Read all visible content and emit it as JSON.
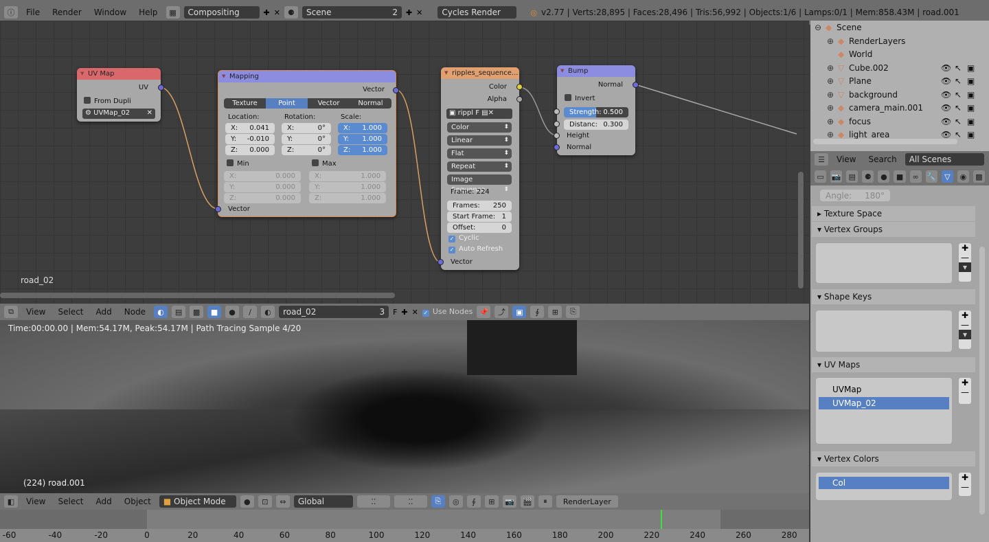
{
  "topbar": {
    "menus": [
      "File",
      "Render",
      "Window",
      "Help"
    ],
    "screen": "Compositing",
    "scene": "Scene",
    "scene_users": "2",
    "engine": "Cycles Render",
    "stats": "v2.77 | Verts:28,895 | Faces:28,496 | Tris:56,992 | Objects:1/6 | Lamps:0/1 | Mem:858.43M | road.001"
  },
  "node_editor": {
    "material_label": "road_02",
    "uvmap": {
      "title": "UV Map",
      "out": "UV",
      "from_dupli": "From Dupli",
      "uv_value": "UVMap_02"
    },
    "mapping": {
      "title": "Mapping",
      "out": "Vector",
      "in": "Vector",
      "tabs": [
        "Texture",
        "Point",
        "Vector",
        "Normal"
      ],
      "active_tab": "Point",
      "location_label": "Location:",
      "rotation_label": "Rotation:",
      "scale_label": "Scale:",
      "location": [
        [
          "X:",
          "0.041"
        ],
        [
          "Y:",
          "-0.010"
        ],
        [
          "Z:",
          "0.000"
        ]
      ],
      "rotation": [
        [
          "X:",
          "0°"
        ],
        [
          "Y:",
          "0°"
        ],
        [
          "Z:",
          "0°"
        ]
      ],
      "scale": [
        [
          "X:",
          "1.000"
        ],
        [
          "Y:",
          "1.000"
        ],
        [
          "Z:",
          "1.000"
        ]
      ],
      "min_label": "Min",
      "max_label": "Max",
      "min": [
        [
          "X:",
          "0.000"
        ],
        [
          "Y:",
          "0.000"
        ],
        [
          "Z:",
          "0.000"
        ]
      ],
      "max": [
        [
          "X:",
          "1.000"
        ],
        [
          "Y:",
          "1.000"
        ],
        [
          "Z:",
          "1.000"
        ]
      ]
    },
    "image": {
      "title": "ripples_sequence...",
      "out_color": "Color",
      "out_alpha": "Alpha",
      "image_name": "rippl",
      "fake": "F",
      "selects": [
        "Color",
        "Linear",
        "Flat",
        "Repeat",
        "Image Sequence"
      ],
      "frame": "Frame: 224",
      "frames_label": "Frames:",
      "frames": "250",
      "start_label": "Start Frame:",
      "start": "1",
      "offset_label": "Offset:",
      "offset": "0",
      "cyclic": "Cyclic",
      "auto_refresh": "Auto Refresh",
      "in": "Vector"
    },
    "bump": {
      "title": "Bump",
      "out": "Normal",
      "invert": "Invert",
      "strength_label": "Strength:",
      "strength": "0.500",
      "strength_fraction": 0.5,
      "distance_label": "Distanc:",
      "distance": "0.300",
      "height": "Height",
      "normal": "Normal"
    }
  },
  "node_header": {
    "menus": [
      "View",
      "Select",
      "Add",
      "Node"
    ],
    "material": "road_02",
    "users": "3",
    "fake": "F",
    "use_nodes": "Use Nodes"
  },
  "render": {
    "status": "Time:00:00.00 | Mem:54.17M, Peak:54.17M | Path Tracing Sample 4/20",
    "object_label": "(224) road.001"
  },
  "view3d_header": {
    "menus": [
      "View",
      "Select",
      "Add",
      "Object"
    ],
    "mode": "Object Mode",
    "orientation": "Global",
    "render_layer": "RenderLayer"
  },
  "timeline": {
    "ticks": [
      "-60",
      "-40",
      "-20",
      "0",
      "20",
      "40",
      "60",
      "80",
      "100",
      "120",
      "140",
      "160",
      "180",
      "200",
      "220",
      "240",
      "260",
      "280"
    ],
    "current_frame": 224,
    "start": 1,
    "end": 250
  },
  "outliner": {
    "items": [
      {
        "label": "Scene",
        "icon": "scene-icon",
        "indent": 0
      },
      {
        "label": "RenderLayers",
        "icon": "render-layers-icon",
        "indent": 1
      },
      {
        "label": "World",
        "icon": "world-icon",
        "indent": 1
      },
      {
        "label": "Cube.002",
        "icon": "mesh-icon",
        "indent": 1
      },
      {
        "label": "Plane",
        "icon": "mesh-icon",
        "indent": 1
      },
      {
        "label": "background",
        "icon": "mesh-icon",
        "indent": 1
      },
      {
        "label": "camera_main.001",
        "icon": "camera-icon",
        "indent": 1
      },
      {
        "label": "focus",
        "icon": "empty-icon",
        "indent": 1
      },
      {
        "label": "light_area",
        "icon": "lamp-icon",
        "indent": 1
      }
    ],
    "header": {
      "view": "View",
      "search": "Search",
      "filter": "All Scenes"
    }
  },
  "properties": {
    "angle_label": "Angle:",
    "angle": "180°",
    "panels": [
      "Texture Space",
      "Vertex Groups",
      "Shape Keys",
      "UV Maps",
      "Vertex Colors"
    ],
    "uv_maps": [
      "UVMap",
      "UVMap_02"
    ],
    "active_uv": "UVMap_02",
    "vertex_colors": [
      "Col"
    ]
  },
  "colors": {
    "accent": "#5680c2",
    "uvmap_header": "#d9686c",
    "vector_header": "#8c8ce0",
    "texture_header": "#e0a070",
    "frame_line": "#3ee03e"
  }
}
